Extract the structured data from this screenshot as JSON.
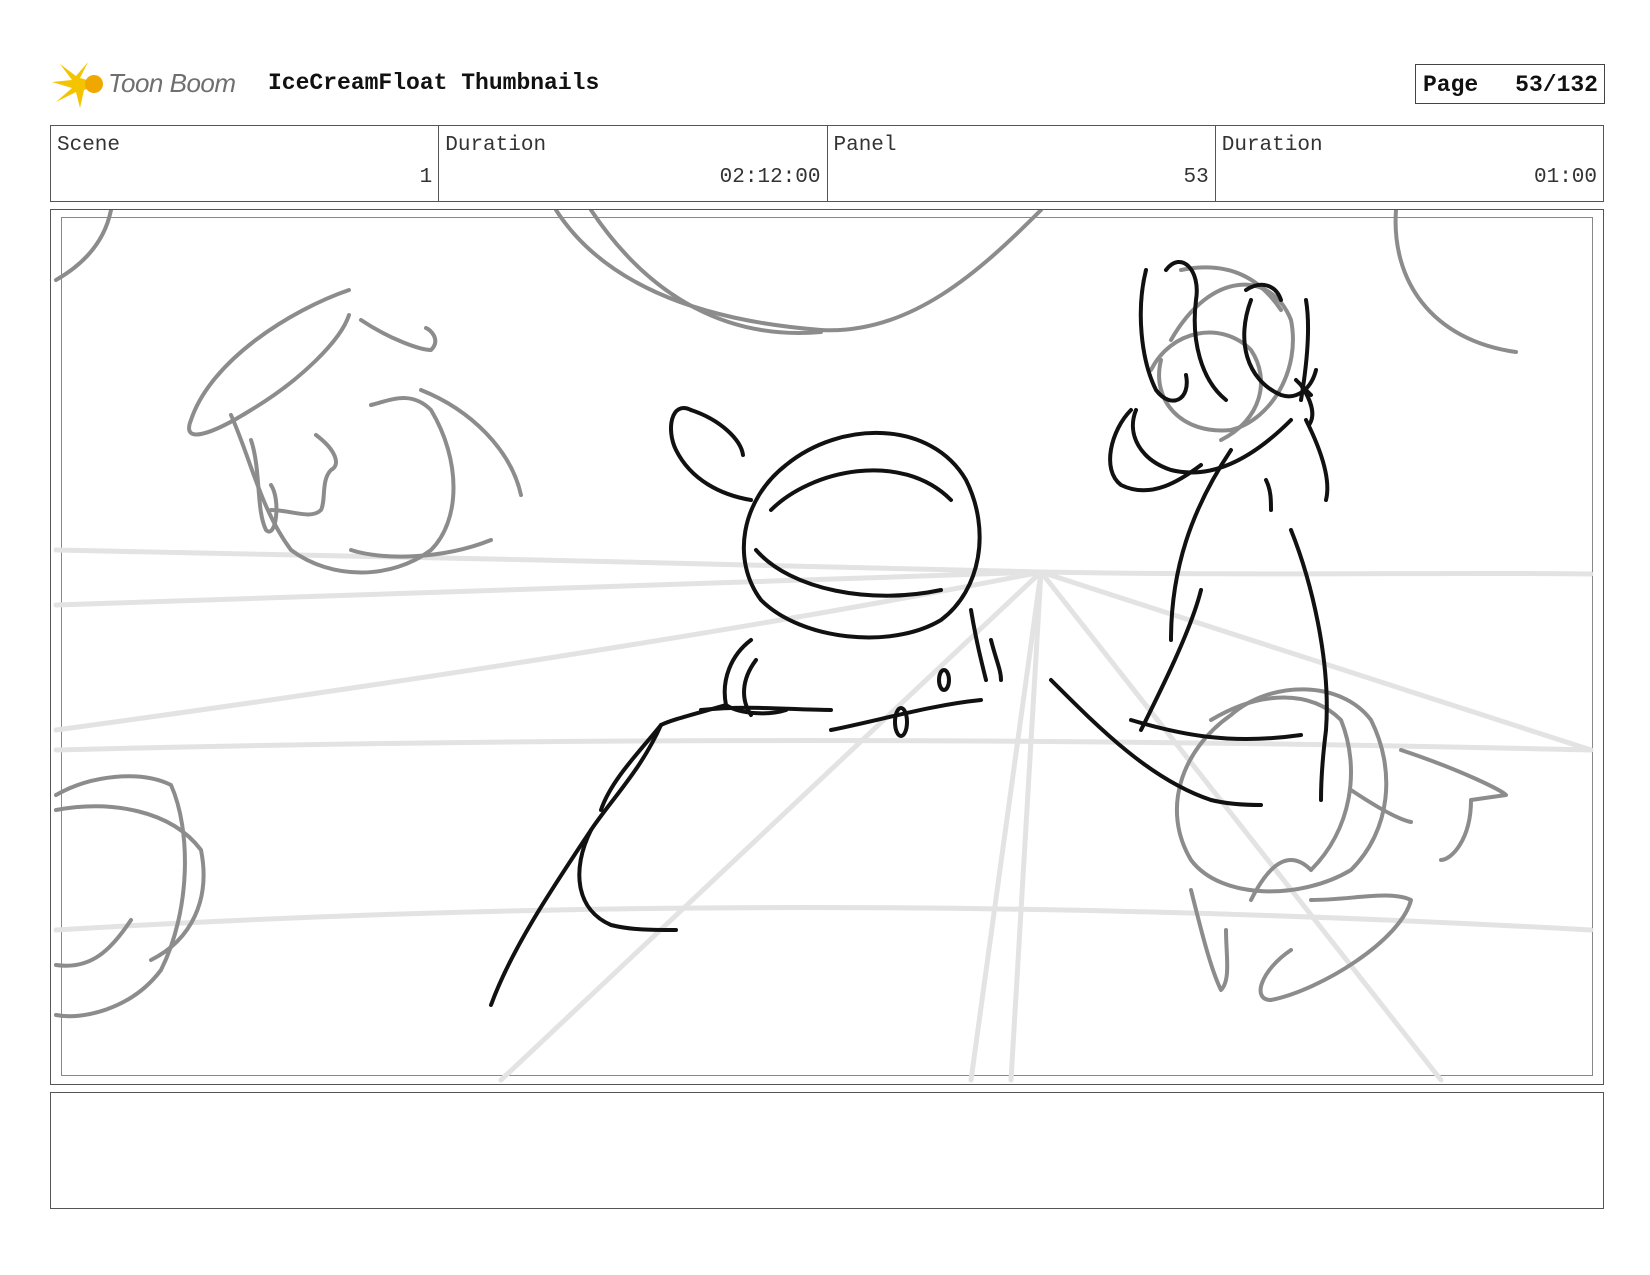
{
  "header": {
    "logo_text": "Toon Boom",
    "title": "IceCreamFloat Thumbnails",
    "page_label": "Page",
    "page_value": "53/132"
  },
  "info": {
    "scene_label": "Scene",
    "scene_value": "1",
    "duration_label": "Duration",
    "duration_value": "02:12:00",
    "panel_label": "Panel",
    "panel_value": "53",
    "panel_duration_label": "Duration",
    "panel_duration_value": "01:00"
  },
  "notes": {
    "text": ""
  },
  "colors": {
    "logo_accent": "#f5c400",
    "ink": "#111111",
    "sketch": "#8c8c8c",
    "guides": "#e3e3e3"
  }
}
